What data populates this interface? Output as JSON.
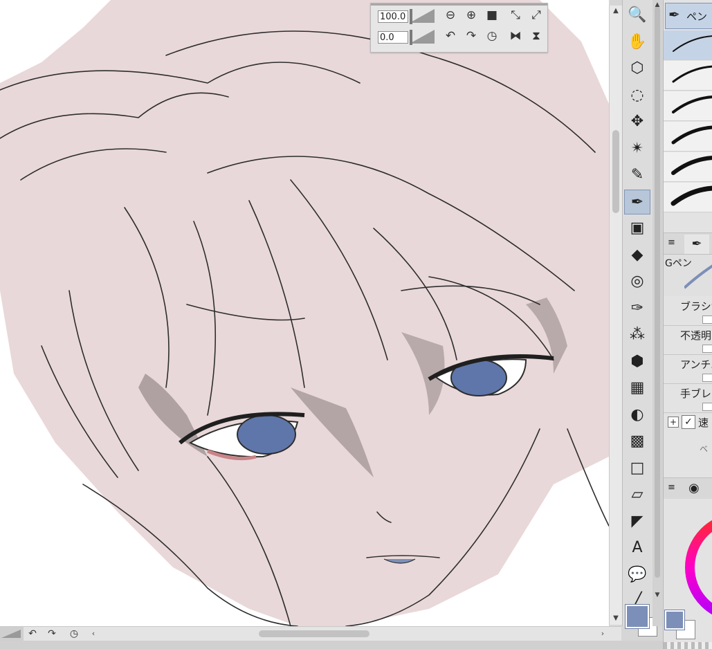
{
  "navigator": {
    "zoom_value": "100.0",
    "rotation_value": "0.0",
    "buttons": {
      "zoom_out": "⊖",
      "zoom_in": "⊕",
      "fit": "■",
      "actual_size": "⤡",
      "fit_window": "⤢",
      "rotate_left": "↶",
      "rotate_right": "↷",
      "reset_rotation": "◷",
      "flip_horizontal": "⧓",
      "flip_vertical": "⧗"
    }
  },
  "canvas_scroll": {
    "up": "▲",
    "down": "▼",
    "left": "‹",
    "right": "›"
  },
  "bottom_bar": {
    "undo": "↶",
    "redo": "↷",
    "reset": "◷"
  },
  "tools": [
    {
      "name": "zoom-tool",
      "glyph": "🔍",
      "active": false
    },
    {
      "name": "hand-tool",
      "glyph": "✋",
      "active": false
    },
    {
      "name": "object-tool",
      "glyph": "⬡",
      "active": false
    },
    {
      "name": "lasso-select-tool",
      "glyph": "◌",
      "active": false
    },
    {
      "name": "move-tool",
      "glyph": "✥",
      "active": false
    },
    {
      "name": "auto-select-tool",
      "glyph": "✴",
      "active": false
    },
    {
      "name": "eyedropper-tool",
      "glyph": "✎",
      "active": false
    },
    {
      "name": "pen-tool",
      "glyph": "✒",
      "active": true
    },
    {
      "name": "reference-thumbnail",
      "glyph": "▣",
      "active": false
    },
    {
      "name": "eraser-tool",
      "glyph": "◆",
      "active": false
    },
    {
      "name": "blend-tool",
      "glyph": "◎",
      "active": false
    },
    {
      "name": "brush-tool",
      "glyph": "✑",
      "active": false
    },
    {
      "name": "airbrush-tool",
      "glyph": "⁂",
      "active": false
    },
    {
      "name": "decoration-tool",
      "glyph": "⬢",
      "active": false
    },
    {
      "name": "figure-ruler-tool",
      "glyph": "▦",
      "active": false
    },
    {
      "name": "fill-tool",
      "glyph": "◐",
      "active": false
    },
    {
      "name": "gradient-tool",
      "glyph": "▩",
      "active": false
    },
    {
      "name": "figure-tool",
      "glyph": "□",
      "active": false
    },
    {
      "name": "frame-tool",
      "glyph": "▱",
      "active": false
    },
    {
      "name": "ruler-tool",
      "glyph": "◤",
      "active": false
    },
    {
      "name": "text-tool",
      "glyph": "A",
      "active": false
    },
    {
      "name": "balloon-tool",
      "glyph": "💬",
      "active": false
    },
    {
      "name": "line-tool",
      "glyph": "╱",
      "active": false
    }
  ],
  "tool_scroll": {
    "up": "▲",
    "down": "▼"
  },
  "colors": {
    "main": "#7c8fb8",
    "sub": "#ffffff",
    "accent": "#b7c6d9"
  },
  "sub_tool_panel": {
    "group_label": "ペン",
    "brush_count": 6
  },
  "tool_property": {
    "tab_icon": "≡",
    "brush_name": "Gペン",
    "properties": [
      {
        "label": "ブラシサ"
      },
      {
        "label": "不透明"
      },
      {
        "label": "アンチエ"
      },
      {
        "label": "手ブレ"
      }
    ],
    "speed_label": "速",
    "bottom_label": "ベ"
  },
  "color_panel": {
    "tab_icon": "≡"
  }
}
